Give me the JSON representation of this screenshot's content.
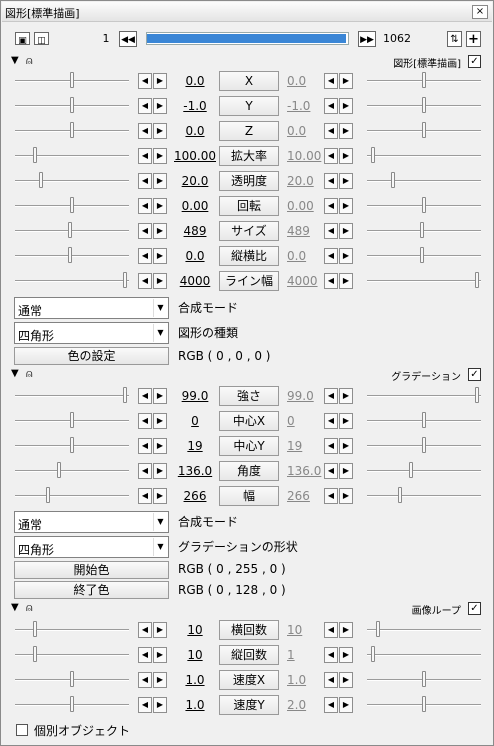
{
  "window": {
    "title": "図形[標準描画]",
    "close": "×"
  },
  "toolbar": {
    "frame_start": "1",
    "frame_end": "1062",
    "frame_progress": 0.99
  },
  "section1": {
    "name": "図形[標準描画]",
    "checked": "✓",
    "params": [
      {
        "label": "X",
        "v1": "0.0",
        "v2": "0.0",
        "t1": 0.5,
        "t2": 0.5
      },
      {
        "label": "Y",
        "v1": "-1.0",
        "v2": "-1.0",
        "t1": 0.5,
        "t2": 0.5
      },
      {
        "label": "Z",
        "v1": "0.0",
        "v2": "0.0",
        "t1": 0.5,
        "t2": 0.5
      },
      {
        "label": "拡大率",
        "v1": "100.00",
        "v2": "10.00",
        "t1": 0.16,
        "t2": 0.04
      },
      {
        "label": "透明度",
        "v1": "20.0",
        "v2": "20.0",
        "t1": 0.22,
        "t2": 0.22
      },
      {
        "label": "回転",
        "v1": "0.00",
        "v2": "0.00",
        "t1": 0.5,
        "t2": 0.5
      },
      {
        "label": "サイズ",
        "v1": "489",
        "v2": "489",
        "t1": 0.48,
        "t2": 0.48
      },
      {
        "label": "縦横比",
        "v1": "0.0",
        "v2": "0.0",
        "t1": 0.48,
        "t2": 0.48
      },
      {
        "label": "ライン幅",
        "v1": "4000",
        "v2": "4000",
        "t1": 0.98,
        "t2": 0.98
      }
    ],
    "blend_mode": "通常",
    "blend_label": "合成モード",
    "shape": "四角形",
    "shape_label": "図形の種類",
    "color_button": "色の設定",
    "color_value": "RGB ( 0 , 0 , 0 )"
  },
  "section2": {
    "name": "グラデーション",
    "checked": "✓",
    "params": [
      {
        "label": "強さ",
        "v1": "99.0",
        "v2": "99.0",
        "t1": 0.98,
        "t2": 0.98
      },
      {
        "label": "中心X",
        "v1": "0",
        "v2": "0",
        "t1": 0.5,
        "t2": 0.5
      },
      {
        "label": "中心Y",
        "v1": "19",
        "v2": "19",
        "t1": 0.5,
        "t2": 0.5
      },
      {
        "label": "角度",
        "v1": "136.0",
        "v2": "136.0",
        "t1": 0.38,
        "t2": 0.38
      },
      {
        "label": "幅",
        "v1": "266",
        "v2": "266",
        "t1": 0.28,
        "t2": 0.28
      }
    ],
    "blend_mode": "通常",
    "blend_label": "合成モード",
    "shape": "四角形",
    "shape_label": "グラデーションの形状",
    "start_button": "開始色",
    "start_value": "RGB ( 0 , 255 , 0 )",
    "end_button": "終了色",
    "end_value": "RGB ( 0 , 128 , 0 )"
  },
  "section3": {
    "name": "画像ループ",
    "checked": "✓",
    "params": [
      {
        "label": "横回数",
        "v1": "10",
        "v2": "10",
        "t1": 0.16,
        "t2": 0.08
      },
      {
        "label": "縦回数",
        "v1": "10",
        "v2": "1",
        "t1": 0.16,
        "t2": 0.04
      },
      {
        "label": "速度X",
        "v1": "1.0",
        "v2": "1.0",
        "t1": 0.5,
        "t2": 0.5
      },
      {
        "label": "速度Y",
        "v1": "1.0",
        "v2": "2.0",
        "t1": 0.5,
        "t2": 0.5
      }
    ],
    "individual_label": "個別オブジェクト"
  }
}
